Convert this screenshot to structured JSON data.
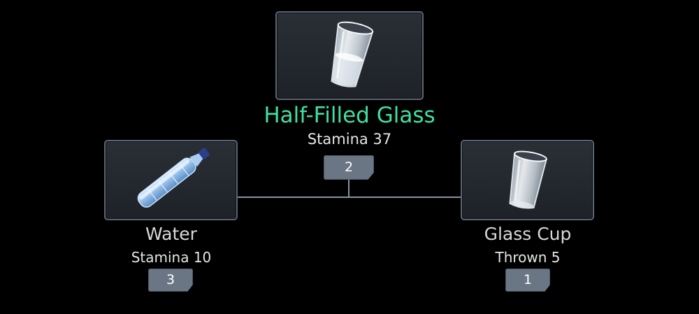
{
  "result": {
    "name": "Half-Filled Glass",
    "stat": "Stamina 37",
    "count": "2",
    "icon": "half-filled-glass-icon",
    "name_color": "#40e0a0"
  },
  "ingredients": [
    {
      "name": "Water",
      "stat": "Stamina 10",
      "count": "3",
      "icon": "water-bottle-icon"
    },
    {
      "name": "Glass Cup",
      "stat": "Thrown 5",
      "count": "1",
      "icon": "glass-cup-icon"
    }
  ]
}
